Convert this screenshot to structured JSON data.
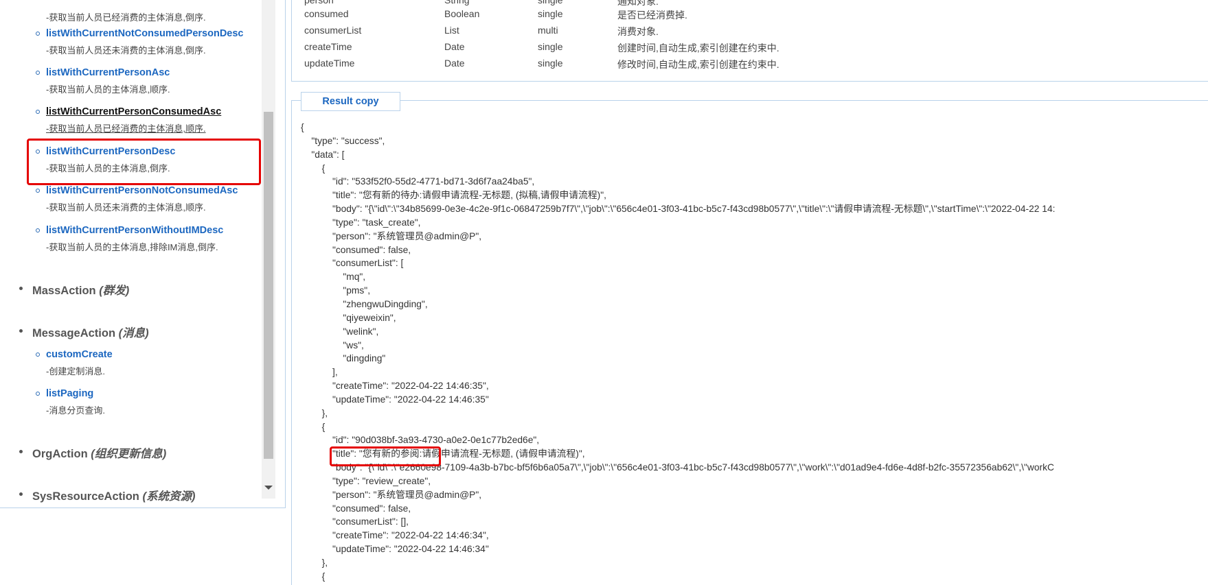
{
  "left_panel": {
    "methods": [
      {
        "name": "",
        "desc": "-获取当前人员已经消费的主体消息,倒序."
      },
      {
        "name": "listWithCurrentNotConsumedPersonDesc",
        "desc": "-获取当前人员还未消费的主体消息,倒序."
      },
      {
        "name": "listWithCurrentPersonAsc",
        "desc": "-获取当前人员的主体消息,顺序."
      },
      {
        "name": "listWithCurrentPersonConsumedAsc",
        "desc": "-获取当前人员已经消费的主体消息,顺序."
      },
      {
        "name": "listWithCurrentPersonDesc",
        "desc": "-获取当前人员的主体消息,倒序."
      },
      {
        "name": "listWithCurrentPersonNotConsumedAsc",
        "desc": "-获取当前人员还未消费的主体消息,顺序."
      },
      {
        "name": "listWithCurrentPersonWithoutIMDesc",
        "desc": "-获取当前人员的主体消息,排除IM消息,倒序."
      }
    ],
    "groups": [
      {
        "name": "MassAction",
        "note": "(群发)"
      },
      {
        "name": "MessageAction",
        "note": "(消息)"
      },
      {
        "name": "OrgAction",
        "note": "(组织更新信息)"
      },
      {
        "name": "SysResourceAction",
        "note": "(系统资源)"
      }
    ],
    "message_methods": [
      {
        "name": "customCreate",
        "desc": "-创建定制消息."
      },
      {
        "name": "listPaging",
        "desc": "-消息分页查询."
      }
    ]
  },
  "properties": [
    {
      "field": "person",
      "type": "String",
      "mode": "single",
      "desc": "通知对象."
    },
    {
      "field": "consumed",
      "type": "Boolean",
      "mode": "single",
      "desc": "是否已经消费掉."
    },
    {
      "field": "consumerList",
      "type": "List",
      "mode": "multi",
      "desc": "消费对象."
    },
    {
      "field": "createTime",
      "type": "Date",
      "mode": "single",
      "desc": "创建时间,自动生成,索引创建在约束中."
    },
    {
      "field": "updateTime",
      "type": "Date",
      "mode": "single",
      "desc": "修改时间,自动生成,索引创建在约束中."
    }
  ],
  "result": {
    "tab_label": "Result copy",
    "json_text": "{\n    \"type\": \"success\",\n    \"data\": [\n        {\n            \"id\": \"533f52f0-55d2-4771-bd71-3d6f7aa24ba5\",\n            \"title\": \"您有新的待办:请假申请流程-无标题, (拟稿,请假申请流程)\",\n            \"body\": \"{\\\"id\\\":\\\"34b85699-0e3e-4c2e-9f1c-06847259b7f7\\\",\\\"job\\\":\\\"656c4e01-3f03-41bc-b5c7-f43cd98b0577\\\",\\\"title\\\":\\\"请假申请流程-无标题\\\",\\\"startTime\\\":\\\"2022-04-22 14:\n            \"type\": \"task_create\",\n            \"person\": \"系统管理员@admin@P\",\n            \"consumed\": false,\n            \"consumerList\": [\n                \"mq\",\n                \"pms\",\n                \"zhengwuDingding\",\n                \"qiyeweixin\",\n                \"welink\",\n                \"ws\",\n                \"dingding\"\n            ],\n            \"createTime\": \"2022-04-22 14:46:35\",\n            \"updateTime\": \"2022-04-22 14:46:35\"\n        },\n        {\n            \"id\": \"90d038bf-3a93-4730-a0e2-0e1c77b2ed6e\",\n            \"title\": \"您有新的参阅:请假申请流程-无标题, (请假申请流程)\",\n            \"body\": \"{\\\"id\\\":\\\"e2660e98-7109-4a3b-b7bc-bf5f6b6a05a7\\\",\\\"job\\\":\\\"656c4e01-3f03-41bc-b5c7-f43cd98b0577\\\",\\\"work\\\":\\\"d01ad9e4-fd6e-4d8f-b2fc-35572356ab62\\\",\\\"workC\n            \"type\": \"review_create\",\n            \"person\": \"系统管理员@admin@P\",\n            \"consumed\": false,\n            \"consumerList\": [],\n            \"createTime\": \"2022-04-22 14:46:34\",\n            \"updateTime\": \"2022-04-22 14:46:34\"\n        },\n        {"
  }
}
